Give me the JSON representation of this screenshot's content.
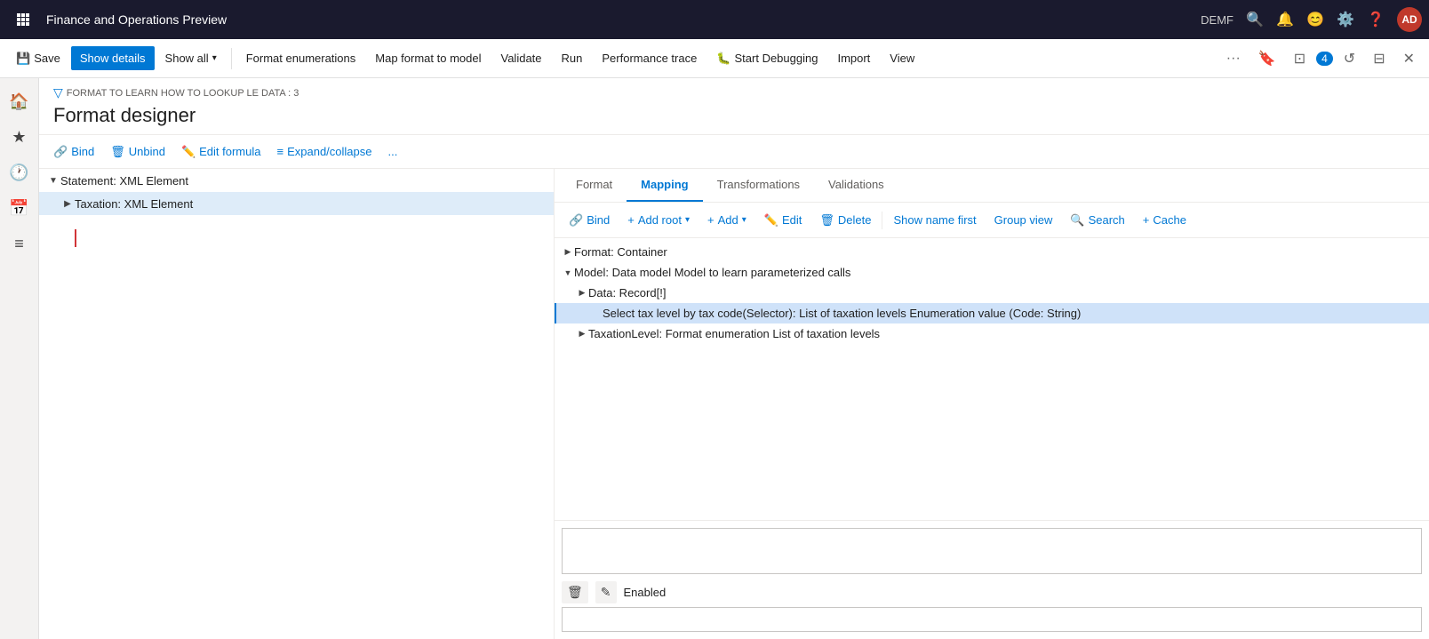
{
  "app": {
    "title": "Finance and Operations Preview",
    "user": "DEMF",
    "avatar": "AD"
  },
  "toolbar": {
    "save_label": "Save",
    "show_details_label": "Show details",
    "show_all_label": "Show all",
    "format_enumerations_label": "Format enumerations",
    "map_format_label": "Map format to model",
    "validate_label": "Validate",
    "run_label": "Run",
    "performance_trace_label": "Performance trace",
    "start_debugging_label": "Start Debugging",
    "import_label": "Import",
    "view_label": "View"
  },
  "page": {
    "breadcrumb": "FORMAT TO LEARN HOW TO LOOKUP LE DATA : 3",
    "title": "Format designer"
  },
  "secondary_toolbar": {
    "bind_label": "Bind",
    "unbind_label": "Unbind",
    "edit_formula_label": "Edit formula",
    "expand_collapse_label": "Expand/collapse",
    "more_label": "..."
  },
  "tabs": {
    "format_label": "Format",
    "mapping_label": "Mapping",
    "transformations_label": "Transformations",
    "validations_label": "Validations"
  },
  "left_tree": {
    "items": [
      {
        "label": "Statement: XML Element",
        "indent": 0,
        "toggle": "▼",
        "selected": false
      },
      {
        "label": "Taxation: XML Element",
        "indent": 1,
        "toggle": "▶",
        "selected": true
      }
    ]
  },
  "mapping_toolbar": {
    "bind_label": "Bind",
    "add_root_label": "Add root",
    "add_label": "Add",
    "edit_label": "Edit",
    "delete_label": "Delete",
    "show_name_first_label": "Show name first",
    "group_view_label": "Group view",
    "search_label": "Search",
    "cache_label": "Cache"
  },
  "data_tree": {
    "items": [
      {
        "label": "Format: Container",
        "indent": 0,
        "toggle": "▶",
        "selected": false,
        "highlighted": false
      },
      {
        "label": "Model: Data model Model to learn parameterized calls",
        "indent": 0,
        "toggle": "▼",
        "selected": false,
        "highlighted": false
      },
      {
        "label": "Data: Record[!]",
        "indent": 1,
        "toggle": "▶",
        "selected": false,
        "highlighted": false
      },
      {
        "label": "Select tax level by tax code(Selector): List of taxation levels Enumeration value (Code: String)",
        "indent": 2,
        "toggle": "",
        "selected": true,
        "highlighted": true
      },
      {
        "label": "TaxationLevel: Format enumeration List of taxation levels",
        "indent": 1,
        "toggle": "▶",
        "selected": false,
        "highlighted": false
      }
    ]
  },
  "bottom": {
    "enabled_label": "Enabled",
    "delete_icon": "🗑",
    "edit_icon": "✎"
  }
}
